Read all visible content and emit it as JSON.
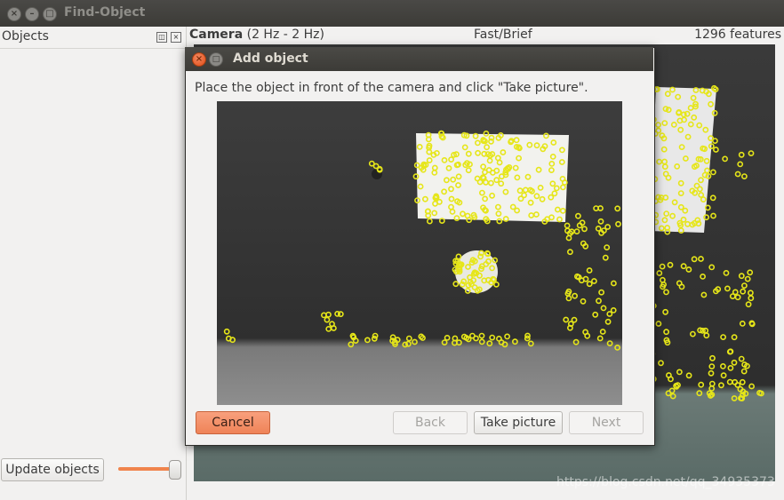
{
  "window": {
    "title": "Find-Object"
  },
  "dock": {
    "title": "Objects",
    "float_icon": "float-icon",
    "close_icon": "close-icon",
    "update_button": "Update objects",
    "slider_value_percent": 100
  },
  "camera": {
    "label_bold": "Camera",
    "label_rate": "(2 Hz - 2 Hz)",
    "detector": "Fast/Brief",
    "feature_count": "1296 features"
  },
  "dialog": {
    "title": "Add object",
    "instruction": "Place the object in front of the camera and click \"Take picture\".",
    "buttons": {
      "cancel": "Cancel",
      "back": "Back",
      "take_picture": "Take picture",
      "next": "Next"
    }
  },
  "watermark": "https://blog.csdn.net/qq_34935373",
  "colors": {
    "accent": "#f0844c",
    "feature_points": "#e6e619",
    "titlebar": "#3c3b37"
  }
}
